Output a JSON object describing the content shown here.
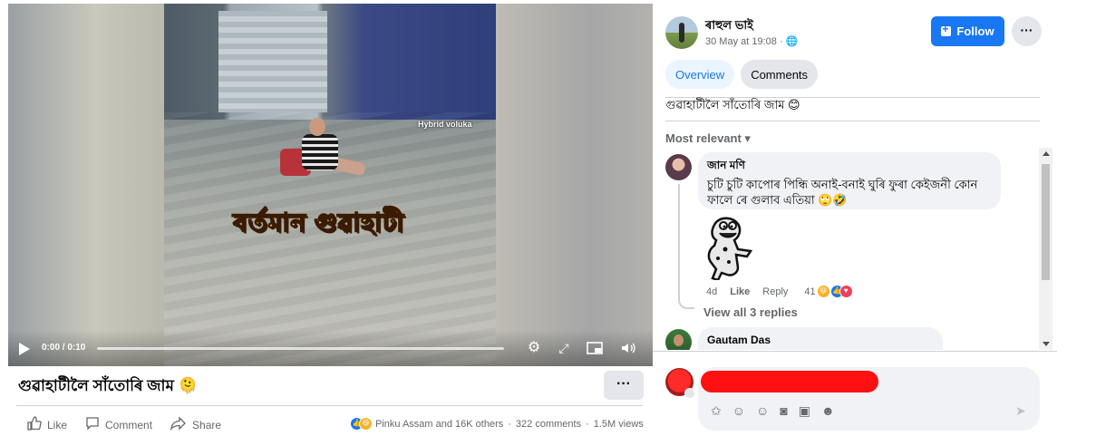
{
  "video": {
    "overlay_text": "বৰ্তমান গুৱাহাটী",
    "watermark": "Hybrid voluka",
    "time": "0:00 / 0:10",
    "progress": 0,
    "title": "গুৱাহাটীলৈ সাঁতোৰি জাম 🫠",
    "more": "···"
  },
  "actions": {
    "like": "Like",
    "comment": "Comment",
    "share": "Share"
  },
  "stats": {
    "reactions_text": "Pinku Assam and 16K others",
    "dot1": "·",
    "comments": "322 comments",
    "dot2": "·",
    "views": "1.5M views"
  },
  "post": {
    "author": "ৰাহুল ভাই",
    "date": "30 May at 19:08 · 🌐",
    "follow": "Follow",
    "more": "···",
    "text": "গুৱাহাটীলৈ সাঁতোৰি জাম 😊"
  },
  "tabs": [
    "Overview",
    "Comments"
  ],
  "sort": "Most relevant ▾",
  "comments": [
    {
      "name": "জান মণি",
      "text": "চুটি চুটি কাপোৰ পিন্ধি অনাই-বনাই ঘুৰি ফুৰা কেইজনী কোন ফালে ৰে গুলাব এতিয়া 🙄🤣",
      "time": "4d",
      "like": "Like",
      "reply": "Reply",
      "reaction_count": "41",
      "view_replies": "View all 3 replies"
    },
    {
      "name": "Gautam Das"
    }
  ],
  "colors": {
    "brand": "#1877f2",
    "redaction": "#ff1010"
  }
}
